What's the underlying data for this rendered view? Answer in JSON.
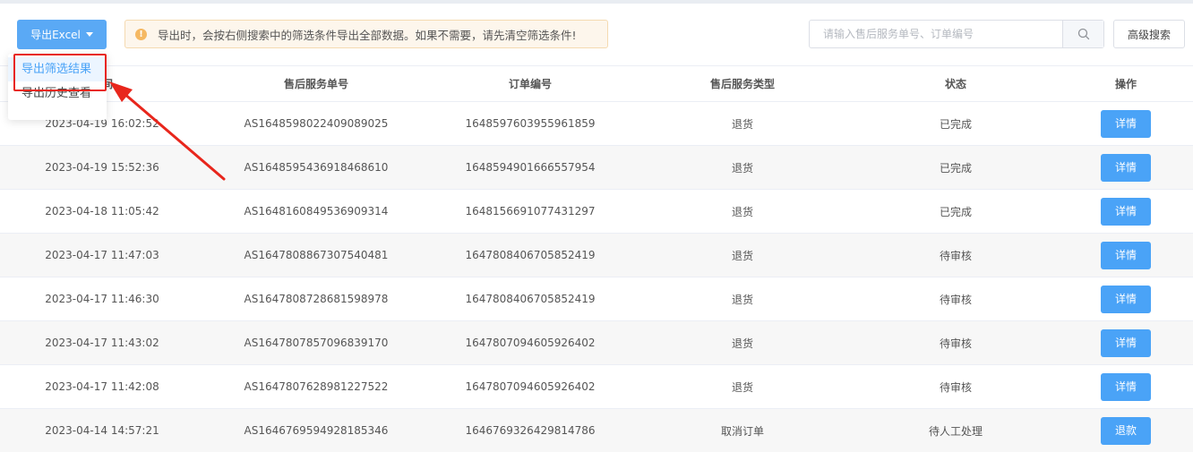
{
  "toolbar": {
    "export_label": "导出Excel",
    "notice_text": "导出时，会按右侧搜索中的筛选条件导出全部数据。如果不需要，请先清空筛选条件!",
    "search_placeholder": "请输入售后服务单号、订单编号",
    "advanced_search_label": "高级搜索"
  },
  "dropdown": {
    "items": [
      "导出筛选结果",
      "导出历史查看"
    ]
  },
  "table": {
    "headers": [
      "时间",
      "售后服务单号",
      "订单编号",
      "售后服务类型",
      "状态",
      "操作"
    ],
    "rows": [
      {
        "time": "2023-04-19 16:02:52",
        "service_no": "AS1648598022409089025",
        "order_no": "1648597603955961859",
        "type": "退货",
        "status": "已完成",
        "action": "详情"
      },
      {
        "time": "2023-04-19 15:52:36",
        "service_no": "AS1648595436918468610",
        "order_no": "1648594901666557954",
        "type": "退货",
        "status": "已完成",
        "action": "详情"
      },
      {
        "time": "2023-04-18 11:05:42",
        "service_no": "AS1648160849536909314",
        "order_no": "1648156691077431297",
        "type": "退货",
        "status": "已完成",
        "action": "详情"
      },
      {
        "time": "2023-04-17 11:47:03",
        "service_no": "AS1647808867307540481",
        "order_no": "1647808406705852419",
        "type": "退货",
        "status": "待审核",
        "action": "详情"
      },
      {
        "time": "2023-04-17 11:46:30",
        "service_no": "AS1647808728681598978",
        "order_no": "1647808406705852419",
        "type": "退货",
        "status": "待审核",
        "action": "详情"
      },
      {
        "time": "2023-04-17 11:43:02",
        "service_no": "AS1647807857096839170",
        "order_no": "1647807094605926402",
        "type": "退货",
        "status": "待审核",
        "action": "详情"
      },
      {
        "time": "2023-04-17 11:42:08",
        "service_no": "AS1647807628981227522",
        "order_no": "1647807094605926402",
        "type": "退货",
        "status": "待审核",
        "action": "详情"
      },
      {
        "time": "2023-04-14 14:57:21",
        "service_no": "AS1646769594928185346",
        "order_no": "1646769326429814786",
        "type": "取消订单",
        "status": "待人工处理",
        "action": "退款"
      }
    ]
  },
  "colors": {
    "primary": "#4aa3f7",
    "annotation_red": "#e8261c",
    "notice_bg": "#fdf6ec"
  }
}
